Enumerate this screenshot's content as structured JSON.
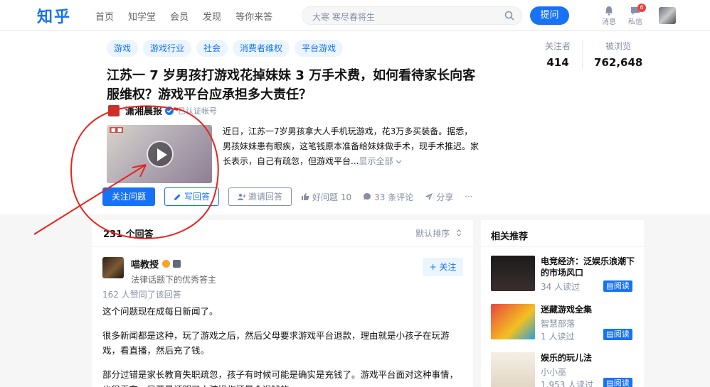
{
  "header": {
    "logo": "知乎",
    "nav": [
      "首页",
      "知学堂",
      "会员",
      "发现",
      "等你来答"
    ],
    "search_placeholder": "大寒 寒尽春将生",
    "ask_label": "提问",
    "notifications_label": "消息",
    "messages_label": "私信",
    "messages_badge": "6"
  },
  "question": {
    "tags": [
      "游戏",
      "游戏行业",
      "社会",
      "消费者维权",
      "平台游戏"
    ],
    "title": "江苏一 7 岁男孩打游戏花掉妹妹 3 万手术费，如何看待家长向客服维权？游戏平台应承担多大责任？",
    "followers_label": "关注者",
    "followers": "414",
    "views_label": "被浏览",
    "views": "762,648",
    "author_name": "潇湘晨报",
    "author_tag": "已认证帐号",
    "excerpt": "近日，江苏一7岁男孩拿大人手机玩游戏，花3万多买装备。据悉，男孩妹妹患有眼疾，这笔钱原本准备给妹妹做手术，现手术推迟。家长表示，自己有疏忽，但游戏平台...",
    "show_all": "显示全部",
    "follow_label": "关注问题",
    "write_label": "写回答",
    "invite_label": "邀请回答",
    "good_label": "好问题 10",
    "comments_label": "33 条评论",
    "share_label": "分享",
    "more_label": "···"
  },
  "answers": {
    "count": "231 个回答",
    "sort": "默认排序",
    "author": "喵教授",
    "author_desc": "法律话题下的优秀答主",
    "follow_label": "+ 关注",
    "upvotes": "162 人赞同了该回答",
    "paragraphs": [
      "这个问题现在成每日新闻了。",
      "很多新闻都是这种，玩了游戏之后，然后父母要求游戏平台退款，理由就是小孩子在玩游戏，看直播，然后充了钱。",
      "部分过错是家长教育失职疏忽，孩子有时候可能是确实是充钱了。游戏平台面对这种事情，也很无奈，只要是证明了小孩操作还是会退钱的。"
    ]
  },
  "sidebar": {
    "title": "相关推荐",
    "read_label": "阅读",
    "books": [
      {
        "title": "电竞经济：泛娱乐浪潮下的市场风口",
        "sub": "34 人读过"
      },
      {
        "title": "迷藏游戏全集",
        "sub": "智慧部落",
        "sub2": "1 人读过"
      },
      {
        "title": "娱乐的玩儿法",
        "sub": "小小巫",
        "sub2": "1,953 人读过"
      }
    ]
  }
}
